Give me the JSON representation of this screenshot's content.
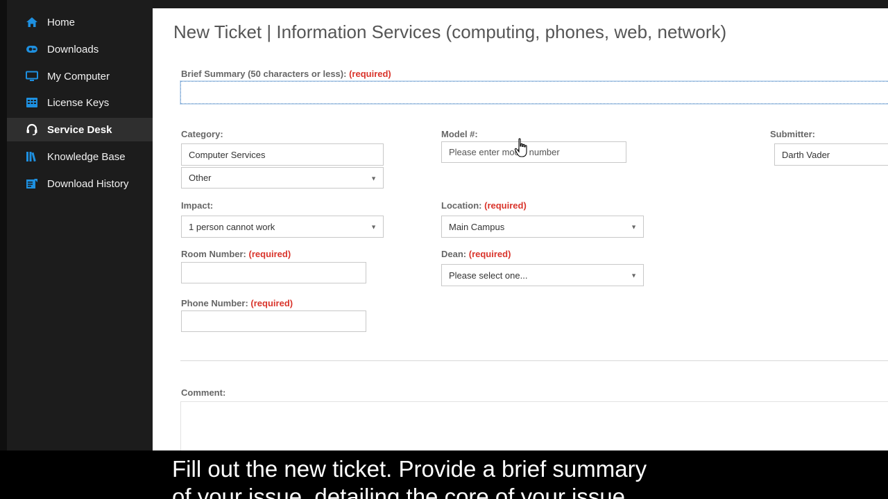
{
  "sidebar": {
    "items": [
      {
        "label": "Home",
        "icon": "home-icon"
      },
      {
        "label": "Downloads",
        "icon": "downloads-icon"
      },
      {
        "label": "My Computer",
        "icon": "monitor-icon"
      },
      {
        "label": "License Keys",
        "icon": "keys-icon"
      },
      {
        "label": "Service Desk",
        "icon": "headset-icon",
        "active": true
      },
      {
        "label": "Knowledge Base",
        "icon": "books-icon"
      },
      {
        "label": "Download History",
        "icon": "history-icon"
      }
    ],
    "icon_color": "#1e90e0"
  },
  "page": {
    "title": "New Ticket | Information Services (computing, phones, web, network)"
  },
  "form": {
    "required_text": "(required)",
    "summary": {
      "label": "Brief Summary (50 characters or less):",
      "value": ""
    },
    "category": {
      "label": "Category:",
      "value": "Computer Services",
      "subvalue": "Other"
    },
    "model": {
      "label": "Model #:",
      "placeholder": "Please enter model number"
    },
    "submitter": {
      "label": "Submitter:",
      "value": "Darth Vader"
    },
    "impact": {
      "label": "Impact:",
      "value": "1 person cannot work"
    },
    "location": {
      "label": "Location:",
      "value": "Main Campus"
    },
    "room": {
      "label": "Room Number:",
      "value": ""
    },
    "dean": {
      "label": "Dean:",
      "value": "Please select one..."
    },
    "phone": {
      "label": "Phone Number:",
      "value": ""
    },
    "comment": {
      "label": "Comment:",
      "value": ""
    }
  },
  "caption": {
    "line1": "Fill out the new ticket. Provide a brief summary",
    "line2": "of your issue, detailing the core of your issue."
  }
}
